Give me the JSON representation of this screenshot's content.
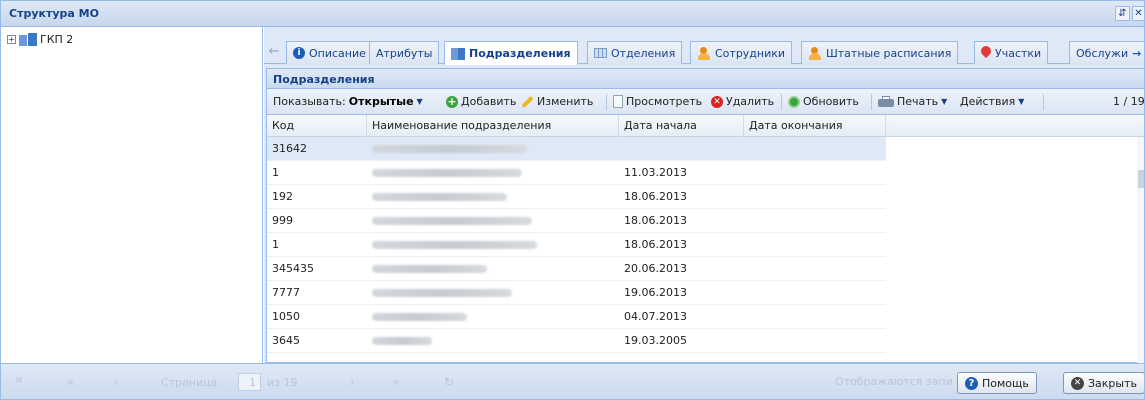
{
  "window": {
    "title": "Структура МО",
    "pin_icon": "pin-icon",
    "close_icon": "close-icon"
  },
  "tree": {
    "items": [
      {
        "label": "ГКП 2",
        "expanded": false
      }
    ]
  },
  "tabs": [
    {
      "label": "Описание",
      "icon": "info-icon"
    },
    {
      "label": "Атрибуты",
      "icon": ""
    },
    {
      "label": "Подразделения",
      "icon": "book-icon",
      "active": true
    },
    {
      "label": "Отделения",
      "icon": "grid-icon"
    },
    {
      "label": "Сотрудники",
      "icon": "people-icon"
    },
    {
      "label": "Штатные расписания",
      "icon": "people-icon"
    },
    {
      "label": "Участки",
      "icon": "location-pin-icon"
    },
    {
      "label": "Обслужи",
      "icon": ""
    }
  ],
  "panel": {
    "title": "Подразделения"
  },
  "toolbar": {
    "show_label": "Показывать:",
    "show_value": "Открытые",
    "add": "Добавить",
    "edit": "Изменить",
    "view": "Просмотреть",
    "delete": "Удалить",
    "refresh": "Обновить",
    "print": "Печать",
    "actions": "Действия",
    "page_info": "1 / 19"
  },
  "grid": {
    "columns": [
      "Код",
      "Наименование подразделения",
      "Дата начала",
      "Дата окончания"
    ],
    "rows": [
      {
        "code": "31642",
        "start": ""
      },
      {
        "code": "1",
        "start": "11.03.2013"
      },
      {
        "code": "192",
        "start": "18.06.2013"
      },
      {
        "code": "999",
        "start": "18.06.2013"
      },
      {
        "code": "1",
        "start": "18.06.2013"
      },
      {
        "code": "345435",
        "start": "20.06.2013"
      },
      {
        "code": "7777",
        "start": "19.06.2013"
      },
      {
        "code": "1050",
        "start": "04.07.2013"
      },
      {
        "code": "3645",
        "start": "19.03.2005"
      }
    ]
  },
  "pager": {
    "page_label": "Страница",
    "page_value": "1",
    "of_label": "из 19",
    "status_text": "Отображаются запи"
  },
  "buttons": {
    "help": "Помощь",
    "close": "Закрыть"
  },
  "colors": {
    "accent": "#15428b",
    "border": "#99bbe8",
    "header_bg": "#dfe8f6",
    "selected_row": "#dfe8f6"
  }
}
